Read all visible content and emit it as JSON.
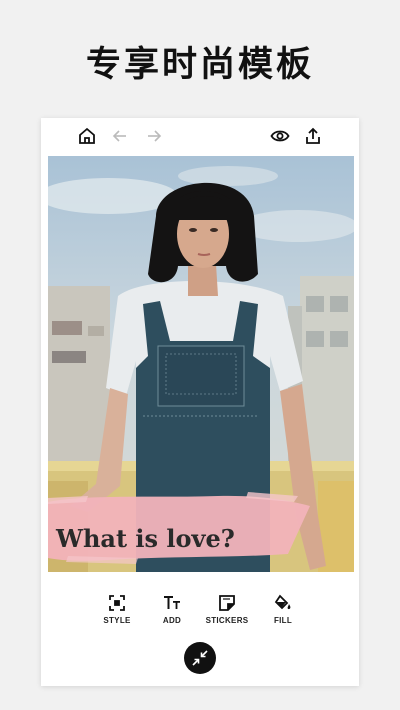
{
  "headline": "专享时尚模板",
  "topbar": {
    "home_icon": "home-icon",
    "undo_icon": "arrow-left-icon",
    "redo_icon": "arrow-right-icon",
    "preview_icon": "eye-icon",
    "share_icon": "share-icon"
  },
  "canvas": {
    "caption": "What is love?"
  },
  "toolbar": {
    "items": [
      {
        "label": "STYLE",
        "icon": "style-icon"
      },
      {
        "label": "ADD",
        "icon": "text-icon"
      },
      {
        "label": "STICKERS",
        "icon": "sticker-icon"
      },
      {
        "label": "FILL",
        "icon": "paint-bucket-icon"
      }
    ]
  },
  "fab_icon": "collapse-icon",
  "colors": {
    "background": "#f1f1f1",
    "brush": "#f2b3ba",
    "fab": "#111111"
  }
}
